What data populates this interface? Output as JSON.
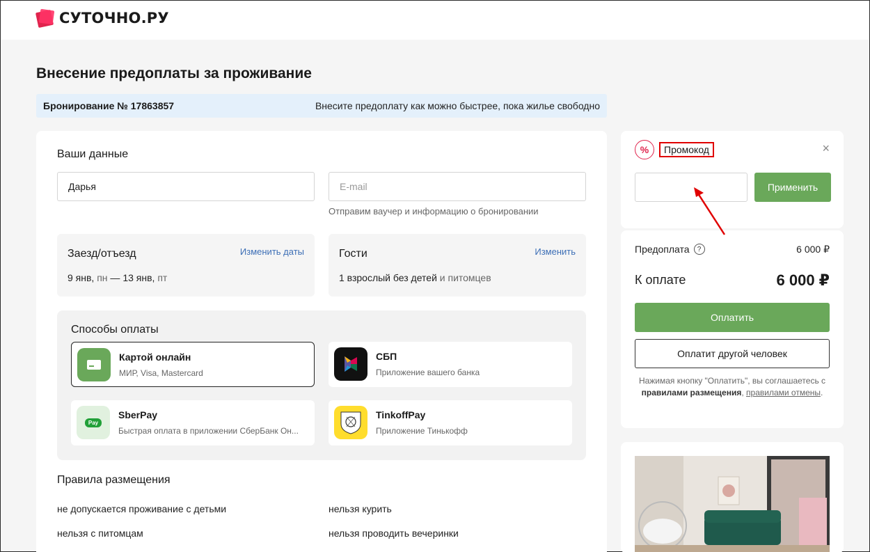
{
  "brand": {
    "name": "СУТОЧНО.РУ",
    "accent": "#e0244d"
  },
  "page": {
    "title": "Внесение предоплаты за проживание"
  },
  "booking": {
    "number_label": "Бронирование № 17863857",
    "note": "Внесите предоплату как можно быстрее, пока жилье свободно"
  },
  "user_data": {
    "title": "Ваши данные",
    "name_value": "Дарья",
    "email_placeholder": "E-mail",
    "email_hint": "Отправим ваучер и информацию о бронировании"
  },
  "dates": {
    "title": "Заезд/отъезд",
    "change_link": "Изменить даты",
    "from_date": "9 янв,",
    "from_day": "пн",
    "sep": "—",
    "to_date": "13 янв,",
    "to_day": "пт"
  },
  "guests": {
    "title": "Гости",
    "change_link": "Изменить",
    "main": "1 взрослый без детей",
    "muted": "и питомцев"
  },
  "payment_methods": {
    "title": "Способы оплаты",
    "options": [
      {
        "name": "Картой онлайн",
        "desc": "МИР, Visa, Mastercard",
        "icon": "card-icon",
        "selected": true
      },
      {
        "name": "СБП",
        "desc": "Приложение вашего банка",
        "icon": "sbp-icon",
        "selected": false
      },
      {
        "name": "SberPay",
        "desc": "Быстрая оплата в приложении СберБанк Он...",
        "icon": "sberpay-icon",
        "icon_text": "Pay",
        "selected": false
      },
      {
        "name": "TinkoffPay",
        "desc": "Приложение Тинькофф",
        "icon": "tinkoff-icon",
        "selected": false
      }
    ]
  },
  "rules": {
    "title": "Правила размещения",
    "items": [
      "не допускается проживание с детьми",
      "нельзя курить",
      "нельзя с питомцам",
      "нельзя проводить вечеринки"
    ]
  },
  "promo": {
    "icon_text": "%",
    "label": "Промокод",
    "close": "×",
    "apply_label": "Применить"
  },
  "summary": {
    "prepay_label": "Предоплата",
    "prepay_help": "?",
    "prepay_value": "6 000 ₽",
    "total_label": "К оплате",
    "total_value": "6 000 ₽",
    "pay_label": "Оплатить",
    "pay_other_label": "Оплатит другой человек",
    "terms_prefix": "Нажимая кнопку \"Оплатить\", вы соглашаетесь с",
    "terms_link1": "правилами размещения",
    "terms_sep": ",",
    "terms_link2": "правилами отмены",
    "terms_end": "."
  },
  "colors": {
    "green": "#6aa85a",
    "link": "#3d6fb6",
    "highlight": "#e00000"
  }
}
